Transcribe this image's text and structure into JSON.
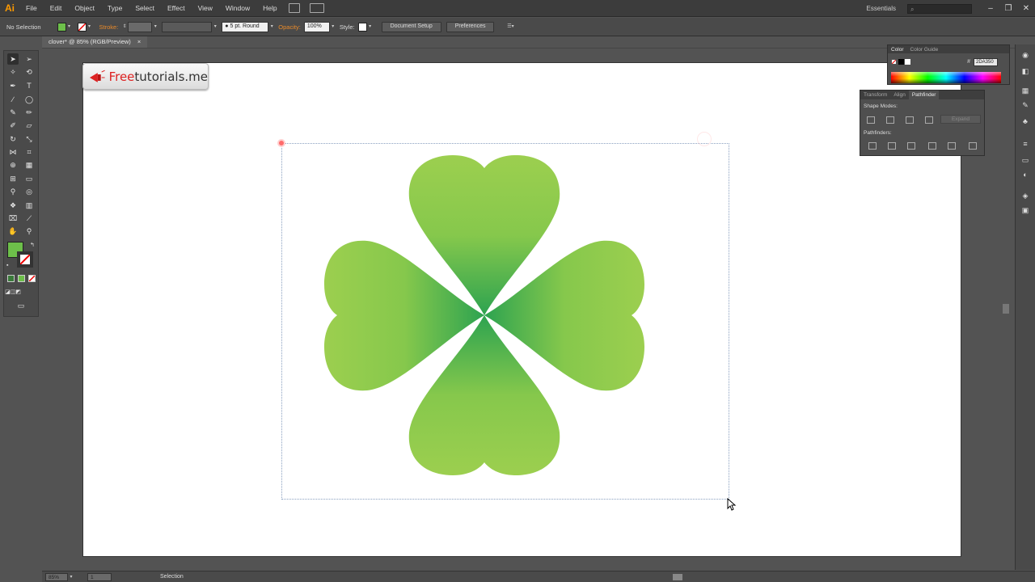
{
  "app": {
    "logo": "Ai",
    "menus": [
      "File",
      "Edit",
      "Object",
      "Type",
      "Select",
      "Effect",
      "View",
      "Window",
      "Help"
    ],
    "workspace": "Essentials",
    "window_controls": [
      "–",
      "❐",
      "✕"
    ]
  },
  "control_bar": {
    "selection_label": "No Selection",
    "stroke_label": "Stroke:",
    "brush_label": "5 pt. Round",
    "opacity_label": "Opacity:",
    "opacity_value": "100%",
    "style_label": "Style:",
    "document_setup": "Document Setup",
    "preferences": "Preferences",
    "fill_color": "#6dbf4a"
  },
  "document": {
    "tab_title": "clover* @ 85% (RGB/Preview)",
    "tab_close": "×"
  },
  "watermark": {
    "prefix": "Free",
    "suffix": "tutorials.me"
  },
  "color_panel": {
    "tabs": [
      "Color",
      "Color Guide"
    ],
    "hex_value": "2DA350",
    "hex_symbol": "#"
  },
  "pathfinder_panel": {
    "tabs": [
      "Transform",
      "Align",
      "Pathfinder"
    ],
    "shape_modes_label": "Shape Modes:",
    "pathfinders_label": "Pathfinders:",
    "expand_button": "Expand"
  },
  "status_bar": {
    "zoom": "85%",
    "artboard": "1",
    "tool": "Selection"
  },
  "colors": {
    "clover_light": "#9ccf4f",
    "clover_dark": "#2da350",
    "accent": "#ff9a00"
  }
}
